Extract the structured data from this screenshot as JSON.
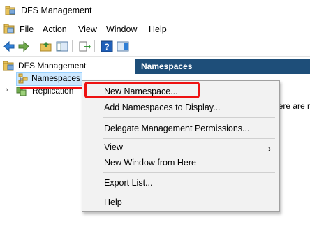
{
  "window": {
    "title": "DFS Management"
  },
  "menubar": {
    "items": [
      "File",
      "Action",
      "View",
      "Window",
      "Help"
    ]
  },
  "tree": {
    "root": "DFS Management",
    "children": [
      {
        "label": "Namespaces"
      },
      {
        "label": "Replication"
      }
    ]
  },
  "right_pane": {
    "header": "Namespaces",
    "partial_text": "here are n"
  },
  "context_menu": {
    "items": [
      "New Namespace...",
      "Add Namespaces to Display...",
      "Delegate Management Permissions...",
      "View",
      "New Window from Here",
      "Export List...",
      "Help"
    ],
    "submenu_arrow": "›"
  },
  "colors": {
    "selection": "#cce8ff",
    "header": "#1e4e79",
    "highlight": "#e11111"
  }
}
